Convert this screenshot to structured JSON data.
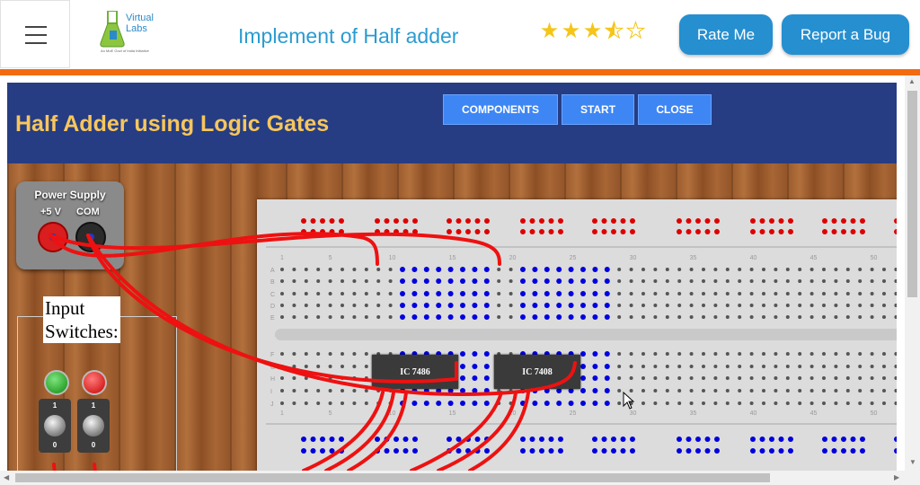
{
  "header": {
    "menu_icon": "hamburger-icon",
    "logo": {
      "line1": "Virtual",
      "line2": "Labs",
      "tagline": "An MoE Govt of India Initiative"
    },
    "title": "Implement of Half adder",
    "rating": {
      "value": 3.5,
      "max": 5,
      "color": "#f5c518"
    },
    "rate_label": "Rate Me",
    "bug_label": "Report a Bug"
  },
  "colors": {
    "accent": "#268fd0",
    "divider": "#f36b0f",
    "sim_header": "#263d84",
    "sim_title": "#f7c65c",
    "sim_button": "#3e86f4"
  },
  "simulator": {
    "title": "Half Adder using Logic Gates",
    "buttons": [
      "COMPONENTS",
      "START",
      "CLOSE"
    ],
    "power_supply": {
      "title": "Power Supply",
      "plus_label": "+5 V",
      "com_label": "COM"
    },
    "input_label_line1": "Input",
    "input_label_line2": "Switches:",
    "switches": [
      {
        "led_color": "green",
        "top": "1",
        "bottom": "0"
      },
      {
        "led_color": "red",
        "top": "1",
        "bottom": "0"
      }
    ],
    "chips": [
      "IC 7486",
      "IC 7408"
    ],
    "column_numbers": [
      "1",
      "5",
      "10",
      "15",
      "20",
      "25",
      "30",
      "35",
      "40",
      "45",
      "50"
    ],
    "row_letters_top": [
      "A",
      "B",
      "C",
      "D",
      "E"
    ],
    "row_letters_bottom": [
      "F",
      "G",
      "H",
      "I",
      "J"
    ]
  }
}
